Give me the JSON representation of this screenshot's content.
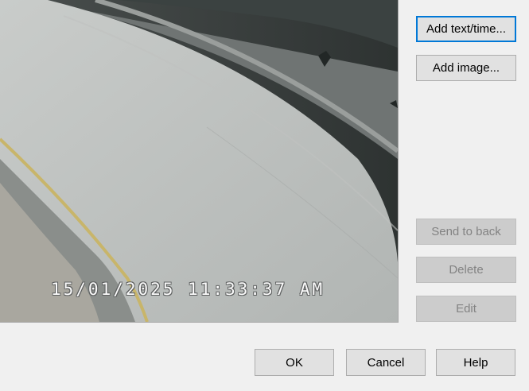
{
  "preview": {
    "timestamp": "15/01/2025 11:33:37 AM"
  },
  "side_buttons": {
    "add_text_time": "Add text/time...",
    "add_image": "Add image...",
    "send_to_back": "Send to back",
    "delete": "Delete",
    "edit": "Edit"
  },
  "dialog_buttons": {
    "ok": "OK",
    "cancel": "Cancel",
    "help": "Help"
  },
  "colors": {
    "accent_focus": "#0078d7",
    "dialog_background": "#f0f0f0",
    "disabled_text": "#838383"
  }
}
